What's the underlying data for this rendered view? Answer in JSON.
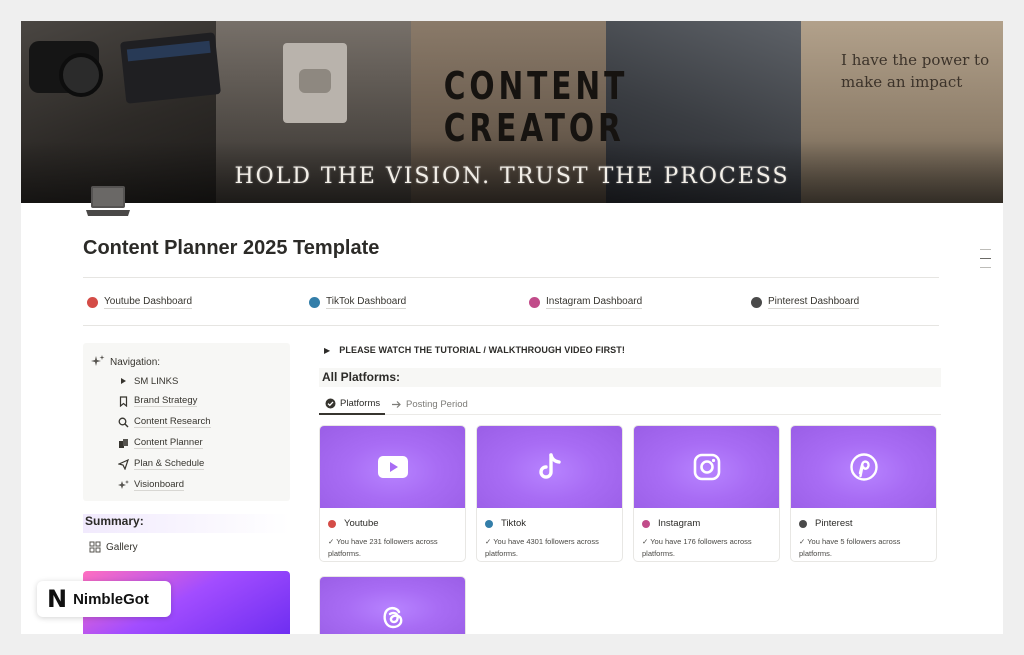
{
  "cover": {
    "poster_line1": "CONTENT",
    "poster_line2": "CREATOR",
    "note_text": "I have the power to make an impact",
    "tagline": "HOLD THE VISION. TRUST THE PROCESS"
  },
  "page": {
    "icon": "laptop-icon",
    "title": "Content Planner 2025 Template"
  },
  "dashboards": [
    {
      "label": "Youtube Dashboard",
      "color": "#d44c47"
    },
    {
      "label": "TikTok Dashboard",
      "color": "#337ea9"
    },
    {
      "label": "Instagram Dashboard",
      "color": "#c14c8a"
    },
    {
      "label": "Pinterest Dashboard",
      "color": "#4a4a4a"
    }
  ],
  "sidebar": {
    "nav_heading": "Navigation:",
    "items": [
      {
        "label": "SM LINKS",
        "icon": "triangle-right-icon"
      },
      {
        "label": "Brand Strategy",
        "icon": "bookmark-icon"
      },
      {
        "label": "Content Research",
        "icon": "search-icon"
      },
      {
        "label": "Content Planner",
        "icon": "pages-icon"
      },
      {
        "label": "Plan & Schedule",
        "icon": "paper-plane-icon"
      },
      {
        "label": "Visionboard",
        "icon": "sparkles-icon"
      }
    ],
    "summary_heading": "Summary:",
    "gallery_label": "Gallery"
  },
  "main": {
    "tutorial_toggle": "PLEASE WATCH THE TUTORIAL / WALKTHROUGH VIDEO FIRST!",
    "section_heading": "All Platforms:",
    "tabs": [
      {
        "label": "Platforms",
        "icon": "check-circle-icon",
        "active": true
      },
      {
        "label": "Posting Period",
        "icon": "arrow-right-icon",
        "active": false
      }
    ],
    "cards": [
      {
        "name": "Youtube",
        "color": "#d44c47",
        "icon": "youtube-icon",
        "desc": "✓ You have 231 followers across platforms."
      },
      {
        "name": "Tiktok",
        "color": "#337ea9",
        "icon": "tiktok-icon",
        "desc": "✓ You have 4301 followers across platforms."
      },
      {
        "name": "Instagram",
        "color": "#c14c8a",
        "icon": "instagram-icon",
        "desc": "✓ You have 176 followers across platforms."
      },
      {
        "name": "Pinterest",
        "color": "#4a4a4a",
        "icon": "pinterest-icon",
        "desc": "✓ You have 5 followers across platforms."
      },
      {
        "name": "",
        "color": "",
        "icon": "threads-icon",
        "desc": ""
      }
    ],
    "accent_color": "#a86cf4"
  },
  "badge": {
    "logo": "N",
    "text": "NimbleGot"
  }
}
